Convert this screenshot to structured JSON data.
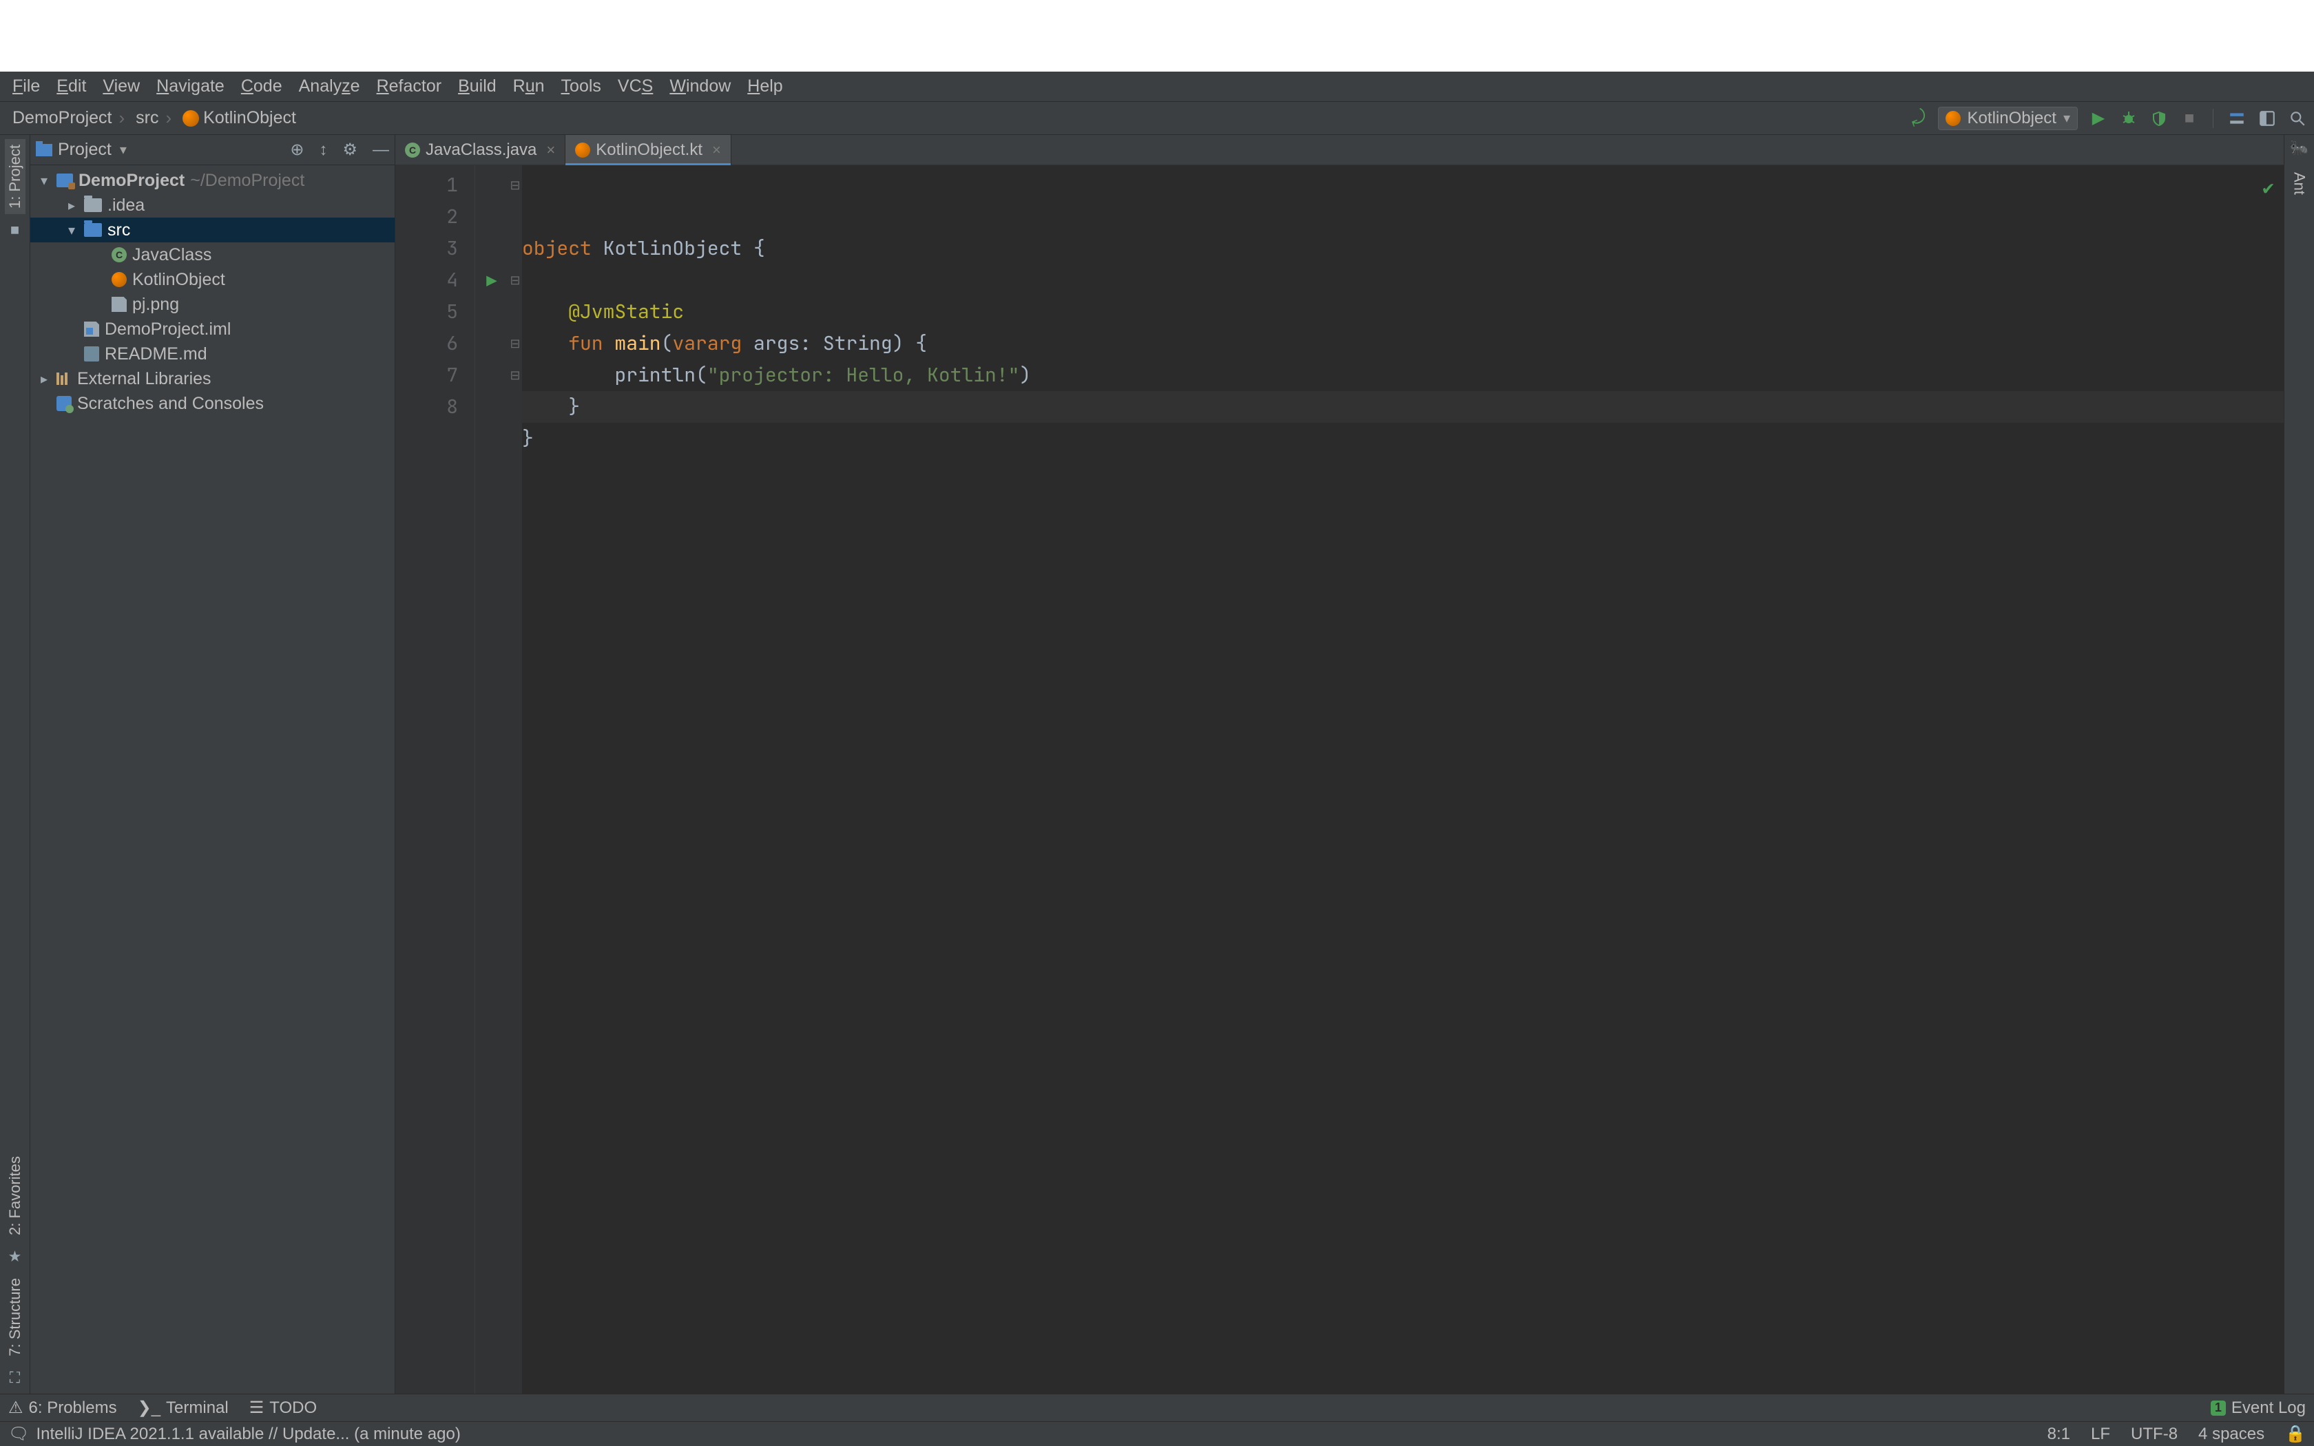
{
  "menu": [
    "File",
    "Edit",
    "View",
    "Navigate",
    "Code",
    "Analyze",
    "Refactor",
    "Build",
    "Run",
    "Tools",
    "VCS",
    "Window",
    "Help"
  ],
  "breadcrumb": {
    "project": "DemoProject",
    "src": "src",
    "file": "KotlinObject"
  },
  "run_config": {
    "name": "KotlinObject"
  },
  "project_panel": {
    "title": "Project",
    "root": {
      "name": "DemoProject",
      "path": "~/DemoProject"
    },
    "idea_folder": ".idea",
    "src_folder": "src",
    "files": {
      "java": "JavaClass",
      "kotlin": "KotlinObject",
      "png": "pj.png",
      "iml": "DemoProject.iml",
      "readme": "README.md"
    },
    "external_libs": "External Libraries",
    "scratches": "Scratches and Consoles"
  },
  "left_tool_windows": {
    "project": "1: Project",
    "favorites": "2: Favorites",
    "structure": "7: Structure"
  },
  "right_tool_windows": {
    "ant": "Ant"
  },
  "tabs": [
    {
      "label": "JavaClass.java",
      "type": "java",
      "active": false
    },
    {
      "label": "KotlinObject.kt",
      "type": "kotlin",
      "active": true
    }
  ],
  "line_numbers": [
    "1",
    "2",
    "3",
    "4",
    "5",
    "6",
    "7",
    "8"
  ],
  "code": {
    "l1_kw": "object",
    "l1_rest": " KotlinObject {",
    "l3_ann": "    @JvmStatic",
    "l4_kw1": "    fun",
    "l4_fn": " main",
    "l4_paren1": "(",
    "l4_kw2": "vararg",
    "l4_rest": " args: String) {",
    "l5_pre": "        println(",
    "l5_str": "\"projector: Hello, Kotlin!\"",
    "l5_post": ")",
    "l6": "    }",
    "l7": "}"
  },
  "bottom_tools": {
    "problems": "6: Problems",
    "terminal": "Terminal",
    "todo": "TODO",
    "event_log": "Event Log",
    "event_badge": "1"
  },
  "status": {
    "msg": "IntelliJ IDEA 2021.1.1 available // Update... (a minute ago)",
    "pos": "8:1",
    "eol": "LF",
    "enc": "UTF-8",
    "indent": "4 spaces"
  }
}
